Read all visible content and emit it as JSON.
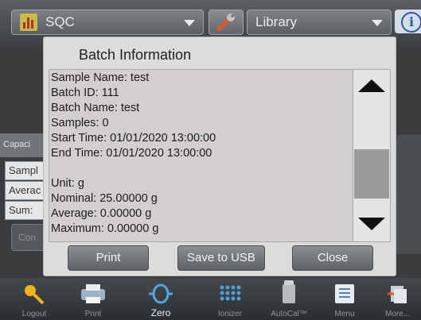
{
  "topbar": {
    "app_selector_label": "SQC",
    "library_label": "Library"
  },
  "background": {
    "capacity_label": "Capaci",
    "fields": [
      "Sampl",
      "Averac",
      "Sum:"
    ],
    "button_label": "Con"
  },
  "dialog": {
    "title": "Batch Information",
    "lines": [
      "Sample Name: test",
      "Batch ID: 111",
      "Batch Name: test",
      "Samples: 0",
      "Start Time: 01/01/2020  13:00:00",
      "End Time: 01/01/2020  13:00:00",
      "",
      "Unit: g",
      "Nominal: 25.00000 g",
      "Average: 0.00000 g",
      "Maximum: 0.00000 g"
    ],
    "buttons": {
      "print": "Print",
      "save_usb": "Save to USB",
      "close": "Close"
    }
  },
  "toolbar": {
    "items": [
      {
        "label": "Logout",
        "icon": "key-icon"
      },
      {
        "label": "Print",
        "icon": "printer-icon"
      },
      {
        "label": "Zero",
        "icon": "zero-icon"
      },
      {
        "label": "Ionizer",
        "icon": "ionizer-icon"
      },
      {
        "label": "AutoCal™",
        "icon": "weight-icon"
      },
      {
        "label": "Menu",
        "icon": "menu-icon"
      },
      {
        "label": "More...",
        "icon": "more-icon"
      }
    ]
  },
  "colors": {
    "dialog_bg": "#dcdcdb",
    "content_bg": "#d3cfcf",
    "button_gradient_top": "#8c8f92",
    "info_blue": "#2a5ea8"
  }
}
